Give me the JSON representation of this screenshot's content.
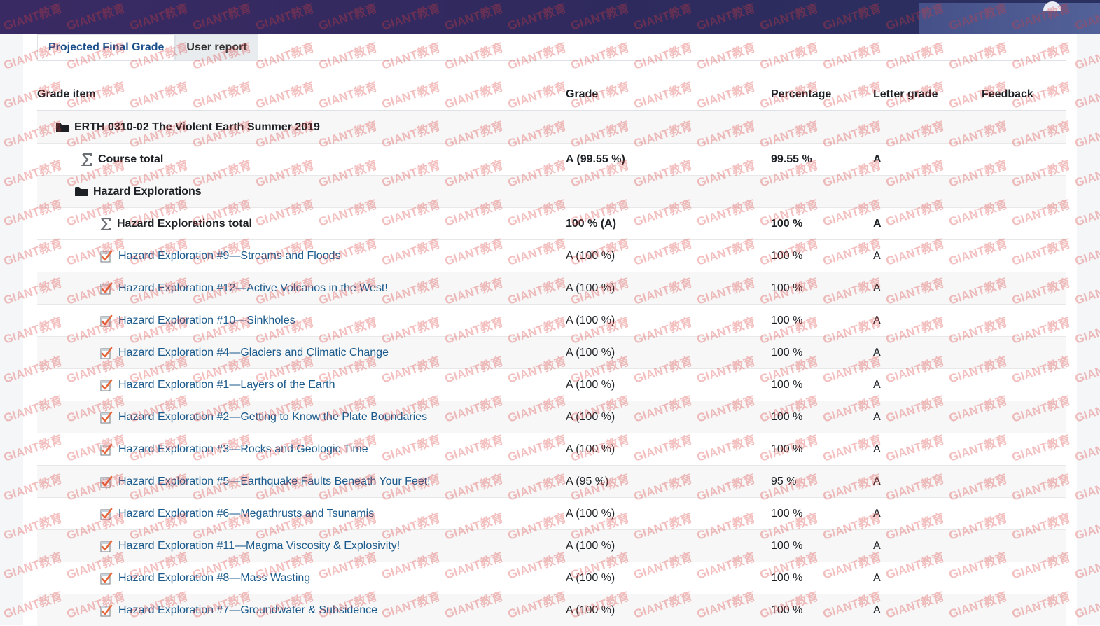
{
  "tabs": [
    {
      "label": "Projected Final Grade",
      "active": true
    },
    {
      "label": "User report",
      "active": false
    }
  ],
  "columns": {
    "item": "Grade item",
    "grade": "Grade",
    "percentage": "Percentage",
    "letter": "Letter grade",
    "feedback": "Feedback"
  },
  "course": {
    "name": "ERTH 0310-02 The Violent Earth Summer 2019",
    "total_label": "Course total",
    "total_grade": "A (99.55 %)",
    "total_pct": "99.55 %",
    "total_letter": "A"
  },
  "category": {
    "name": "Hazard Explorations",
    "total_label": "Hazard Explorations total",
    "total_grade": "100 % (A)",
    "total_pct": "100 %",
    "total_letter": "A"
  },
  "items": [
    {
      "name": "Hazard Exploration #9—Streams and Floods",
      "grade": "A (100 %)",
      "pct": "100 %",
      "letter": "A"
    },
    {
      "name": "Hazard Exploration #12—Active Volcanos in the West!",
      "grade": "A (100 %)",
      "pct": "100 %",
      "letter": "A"
    },
    {
      "name": "Hazard Exploration #10—Sinkholes",
      "grade": "A (100 %)",
      "pct": "100 %",
      "letter": "A"
    },
    {
      "name": "Hazard Exploration #4—Glaciers and Climatic Change",
      "grade": "A (100 %)",
      "pct": "100 %",
      "letter": "A"
    },
    {
      "name": "Hazard Exploration #1—Layers of the Earth",
      "grade": "A (100 %)",
      "pct": "100 %",
      "letter": "A"
    },
    {
      "name": "Hazard Exploration #2—Getting to Know the Plate Boundaries",
      "grade": "A (100 %)",
      "pct": "100 %",
      "letter": "A"
    },
    {
      "name": "Hazard Exploration #3—Rocks and Geologic Time",
      "grade": "A (100 %)",
      "pct": "100 %",
      "letter": "A"
    },
    {
      "name": "Hazard Exploration #5—Earthquake Faults Beneath Your Feet!",
      "grade": "A (95 %)",
      "pct": "95 %",
      "letter": "A"
    },
    {
      "name": "Hazard Exploration #6—Megathrusts and Tsunamis",
      "grade": "A (100 %)",
      "pct": "100 %",
      "letter": "A"
    },
    {
      "name": "Hazard Exploration #11—Magma Viscosity & Explosivity!",
      "grade": "A (100 %)",
      "pct": "100 %",
      "letter": "A"
    },
    {
      "name": "Hazard Exploration #8—Mass Wasting",
      "grade": "A (100 %)",
      "pct": "100 %",
      "letter": "A"
    },
    {
      "name": "Hazard Exploration #7—Groundwater & Subsidence",
      "grade": "A (100 %)",
      "pct": "100 %",
      "letter": "A"
    }
  ],
  "watermark": "GIANT教育",
  "colors": {
    "topbar": "#2f2a5e",
    "link": "#1a5a8c",
    "watermark": "#dc3c3c",
    "assign_icon_accent": "#e5673a"
  }
}
